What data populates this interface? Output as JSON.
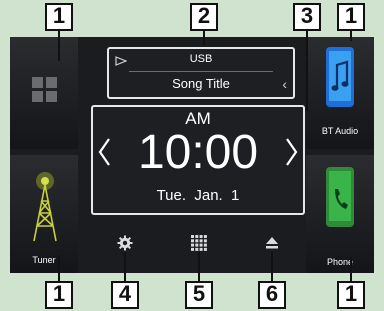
{
  "callouts": {
    "c1": "1",
    "c2": "2",
    "c3": "3",
    "c4": "4",
    "c5": "5",
    "c6": "6"
  },
  "source": {
    "name": "USB",
    "track": "Song Title"
  },
  "clock": {
    "ampm": "AM",
    "time": "10:00",
    "date": "Tue.  Jan.  1"
  },
  "tiles": {
    "bt_audio": {
      "label": "BT Audio"
    },
    "tuner": {
      "label": "Tuner"
    },
    "phone": {
      "label": "Phone"
    }
  },
  "colors": {
    "background": "#cfe3cf",
    "screen": "#1a1c1f",
    "bt_blue": "#1f6fd6",
    "phone_green": "#38b449",
    "tuner_yellow": "#c8d33a"
  },
  "icons": {
    "play": "play-icon",
    "source_list": "grid-icon",
    "prev": "chevron-left-icon",
    "next": "chevron-right-icon",
    "settings": "gear-icon",
    "menu": "grid-icon",
    "eject": "eject-icon"
  }
}
